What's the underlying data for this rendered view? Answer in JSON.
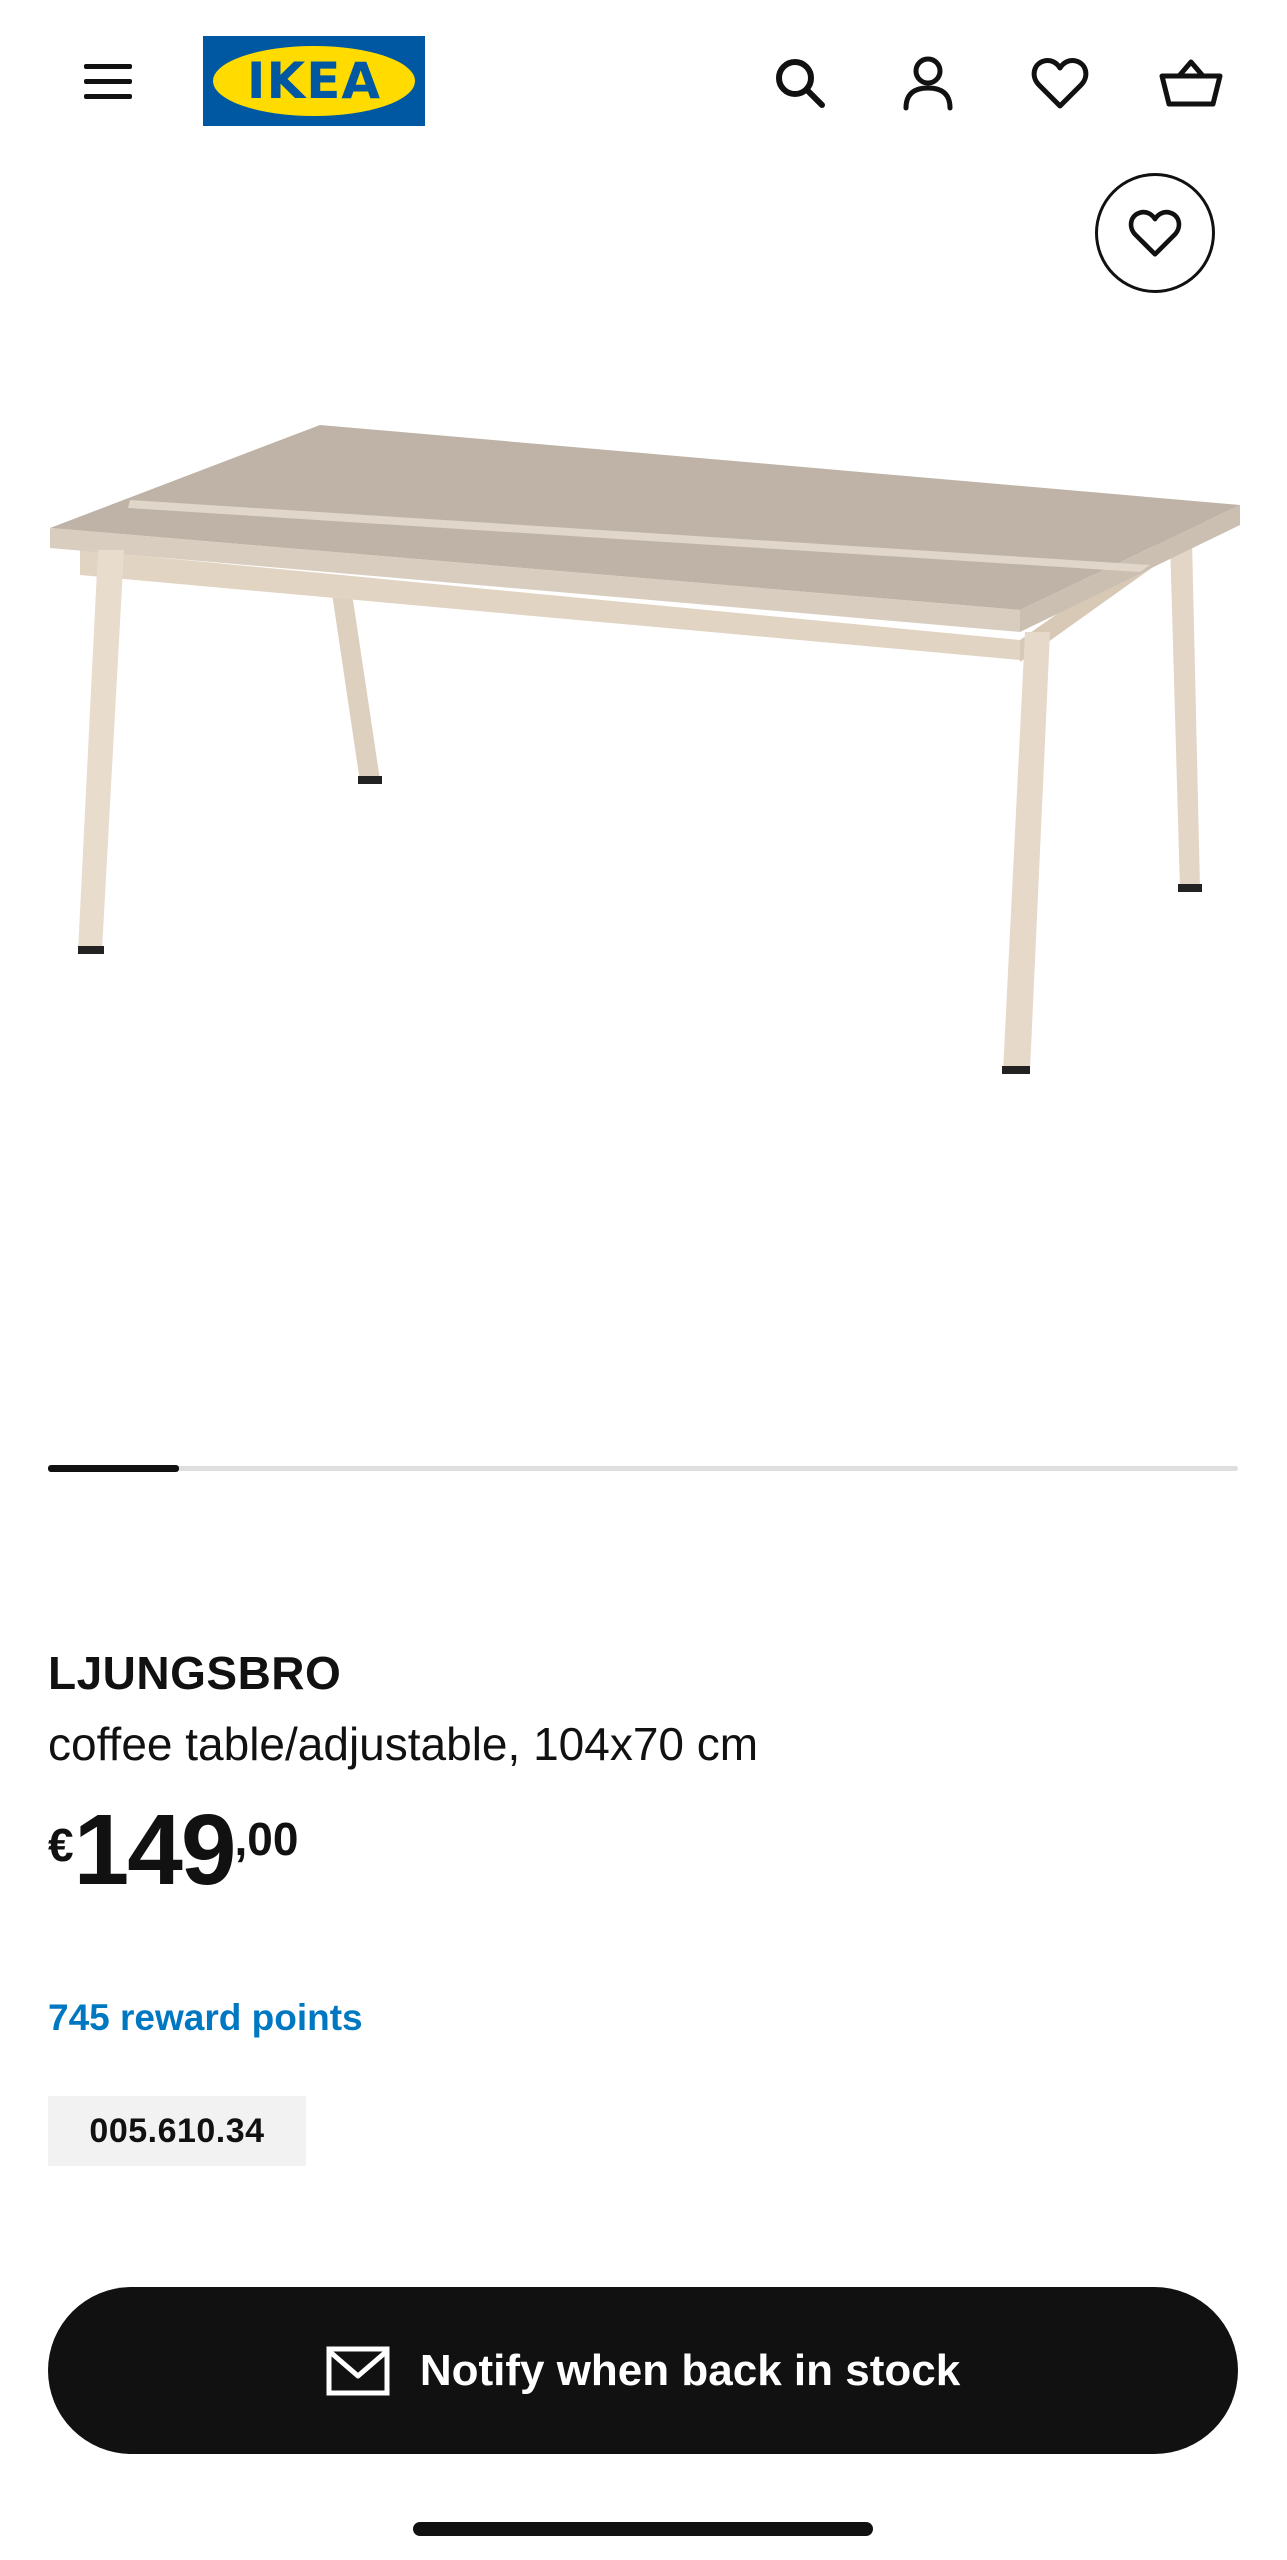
{
  "header": {
    "menu_icon": "hamburger-menu-icon",
    "logo_text": "IKEA",
    "search_icon": "search-icon",
    "account_icon": "account-icon",
    "wishlist_icon": "heart-icon",
    "cart_icon": "basket-icon"
  },
  "gallery": {
    "favourite_icon": "heart-icon",
    "progress": 0.11,
    "image_alt": "coffee table"
  },
  "product": {
    "name": "LJUNGSBRO",
    "description": "coffee table/adjustable, 104x70 cm",
    "price": {
      "currency": "€",
      "integer": "149",
      "decimals": ",00"
    },
    "reward_points": "745 reward points",
    "article_number": "005.610.34"
  },
  "actions": {
    "notify_label": "Notify when back in stock",
    "notify_icon": "mail-icon"
  },
  "colors": {
    "brand_blue": "#0058a3",
    "brand_yellow": "#ffdb00",
    "link_blue": "#0077c1",
    "button_black": "#111111"
  }
}
